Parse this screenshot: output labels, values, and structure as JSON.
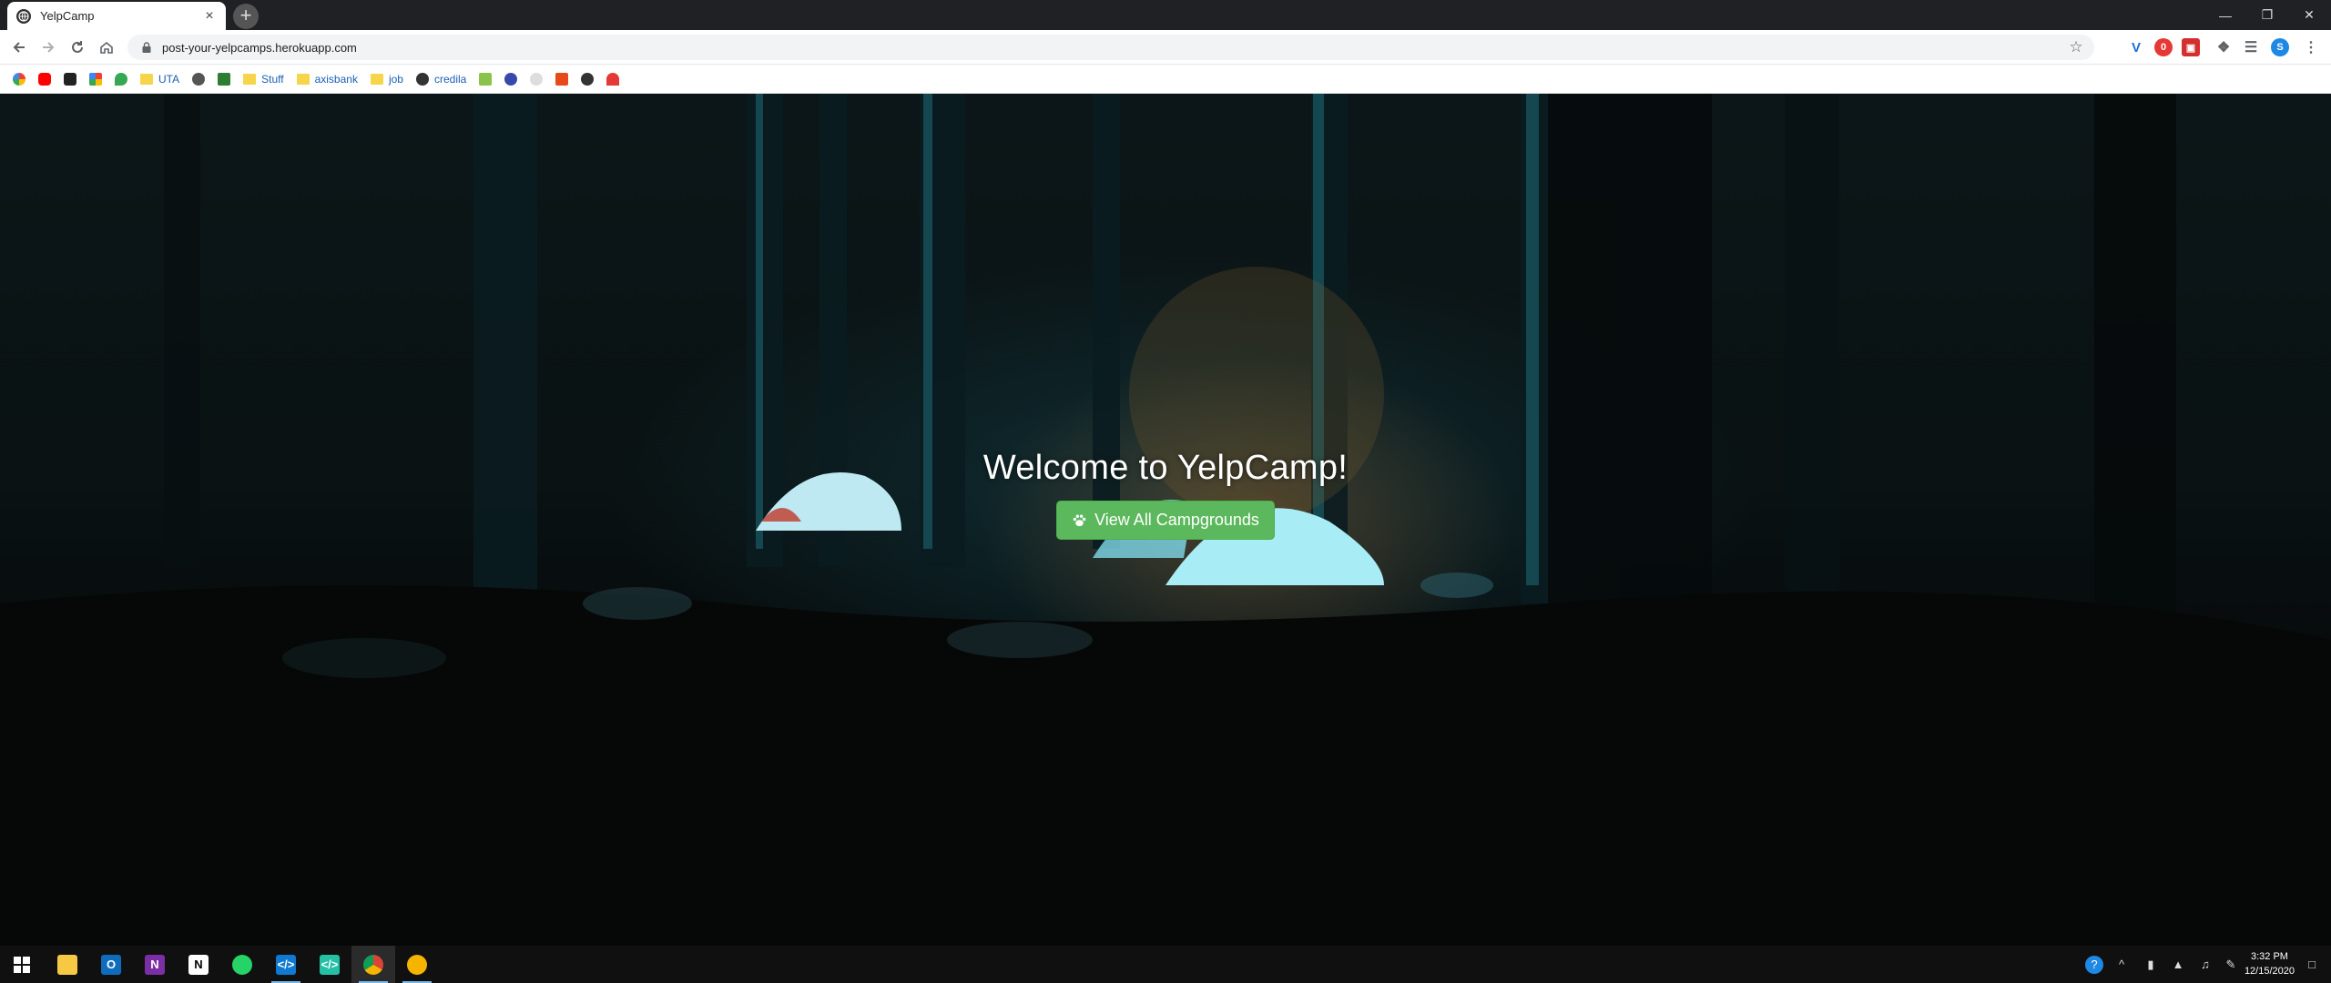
{
  "browser": {
    "tab_title": "YelpCamp",
    "new_tab_label": "+",
    "url": "post-your-yelpcamps.herokuapp.com"
  },
  "bookmarks": [
    {
      "label": "",
      "icon": "google-icon"
    },
    {
      "label": "",
      "icon": "youtube-icon"
    },
    {
      "label": "",
      "icon": "amazon-icon"
    },
    {
      "label": "",
      "icon": "photos-icon"
    },
    {
      "label": "",
      "icon": "maps-icon"
    },
    {
      "label": "UTA",
      "icon": "folder-icon"
    },
    {
      "label": "",
      "icon": "apple-icon"
    },
    {
      "label": "",
      "icon": "site-icon"
    },
    {
      "label": "Stuff",
      "icon": "folder-icon"
    },
    {
      "label": "axisbank",
      "icon": "folder-icon"
    },
    {
      "label": "job",
      "icon": "folder-icon"
    },
    {
      "label": "credila",
      "icon": "globe-icon"
    }
  ],
  "hero": {
    "heading": "Welcome to YelpCamp!",
    "button_label": "View All Campgrounds"
  },
  "taskbar": {
    "time": "3:32 PM",
    "date": "12/15/2020"
  },
  "colors": {
    "button_green": "#5cb85c",
    "tab_bar": "#202124",
    "taskbar": "#101010"
  }
}
